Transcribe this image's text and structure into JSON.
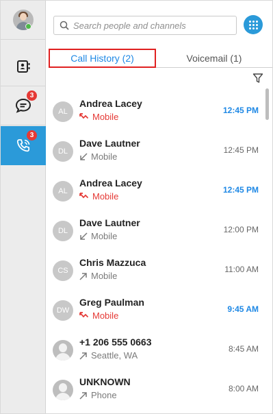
{
  "search": {
    "placeholder": "Search people and channels"
  },
  "tabs": [
    {
      "label": "Call History (2)",
      "active": true
    },
    {
      "label": "Voicemail (1)",
      "active": false
    }
  ],
  "rail": {
    "chat_badge": "3",
    "calls_badge": "3"
  },
  "calls": [
    {
      "initials": "AL",
      "name": "Andrea Lacey",
      "detail": "Mobile",
      "type": "missed",
      "time": "12:45 PM"
    },
    {
      "initials": "DL",
      "name": "Dave Lautner",
      "detail": "Mobile",
      "type": "incoming",
      "time": "12:45 PM"
    },
    {
      "initials": "AL",
      "name": "Andrea Lacey",
      "detail": "Mobile",
      "type": "missed",
      "time": "12:45 PM"
    },
    {
      "initials": "DL",
      "name": "Dave Lautner",
      "detail": "Mobile",
      "type": "incoming",
      "time": "12:00 PM"
    },
    {
      "initials": "CS",
      "name": "Chris Mazzuca",
      "detail": "Mobile",
      "type": "outgoing",
      "time": "11:00 AM"
    },
    {
      "initials": "DW",
      "name": "Greg Paulman",
      "detail": "Mobile",
      "type": "missed",
      "time": "9:45 AM"
    },
    {
      "initials": "",
      "name": "+1 206 555 0663",
      "detail": "Seattle, WA",
      "type": "outgoing",
      "time": "8:45 AM"
    },
    {
      "initials": "",
      "name": "UNKNOWN",
      "detail": "Phone",
      "type": "outgoing",
      "time": "8:00 AM"
    }
  ],
  "colors": {
    "accent": "#2b9ad9",
    "missed": "#e53935",
    "link": "#1e88e5"
  }
}
